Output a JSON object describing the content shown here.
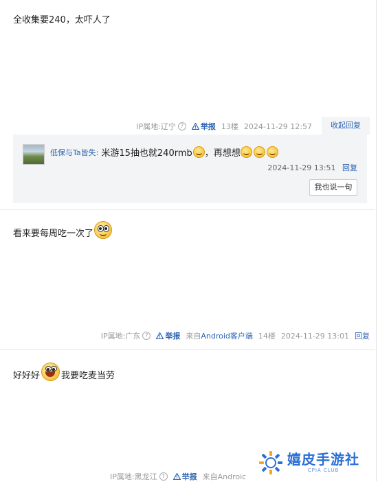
{
  "posts": [
    {
      "content": "全收集要240，太吓人了",
      "ip": "IP属地:辽宁",
      "report": "举报",
      "floor": "13楼",
      "time": "2024-11-29 12:57",
      "action": "收起回复",
      "sub_reply": {
        "author": "低保与Ta皆失:",
        "text_a": "米游15抽也就240rmb",
        "text_b": "，再想想",
        "time": "2024-11-29 13:51",
        "reply": "回复",
        "say_button": "我也说一句"
      }
    },
    {
      "content": "看来要每周吃一次了",
      "ip": "IP属地:广东",
      "report": "举报",
      "source": "来自Android客户端",
      "floor": "14楼",
      "time": "2024-11-29 13:01",
      "action": "回复"
    },
    {
      "content_a": "好好好",
      "content_b": "我要吃麦当劳",
      "ip": "IP属地:黑龙江",
      "report": "举报",
      "source": "来自Androic"
    }
  ],
  "watermark": {
    "title": "嬉皮手游社",
    "subtitle": "CPIA CLUB"
  },
  "icons": {
    "help": "question-circle-icon",
    "warn": "warning-triangle-icon"
  },
  "colors": {
    "link": "#2d64b3",
    "muted": "#999999",
    "subbox_bg": "#f3f4f6"
  }
}
